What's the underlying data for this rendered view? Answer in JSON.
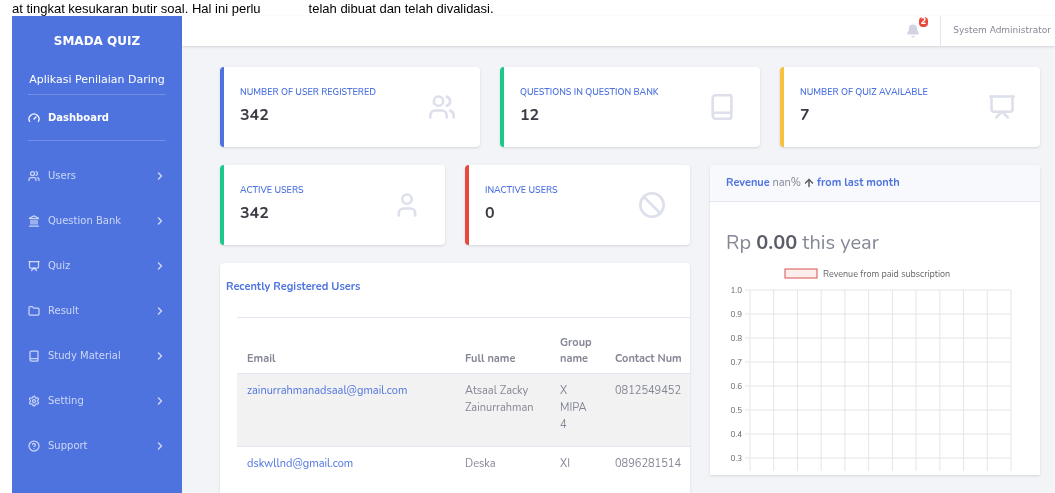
{
  "document_text": [
    "at tingkat kesukaran butir soal. Hal ini perlu",
    "telah dibuat dan telah divalidasi."
  ],
  "sidebar": {
    "brand": "SMADA QUIZ",
    "subtitle": "Aplikasi Penilaian Daring",
    "items": [
      {
        "kind": "dashboard",
        "label": "Dashboard",
        "selected": true
      },
      {
        "kind": "users",
        "label": "Users",
        "selected": false
      },
      {
        "kind": "bank",
        "label": "Question Bank",
        "selected": false
      },
      {
        "kind": "quiz",
        "label": "Quiz",
        "selected": false
      },
      {
        "kind": "result",
        "label": "Result",
        "selected": false
      },
      {
        "kind": "material",
        "label": "Study Material",
        "selected": false
      },
      {
        "kind": "setting",
        "label": "Setting",
        "selected": false
      },
      {
        "kind": "support",
        "label": "Support",
        "selected": false
      }
    ]
  },
  "topbar": {
    "notification_count": "2",
    "user": "System Administrator"
  },
  "stat_cards": [
    {
      "kind": "users",
      "label": "NUMBER OF USER REGISTERED",
      "value": "342",
      "color": "#4e73df"
    },
    {
      "kind": "book",
      "label": "QUESTIONS IN QUESTION BANK",
      "value": "12",
      "color": "#1cc88a"
    },
    {
      "kind": "quiz",
      "label": "NUMBER OF QUIZ AVAILABLE",
      "value": "7",
      "color": "#f6c23e"
    },
    {
      "kind": "user",
      "label": "ACTIVE USERS",
      "value": "342",
      "color": "#1cc88a"
    },
    {
      "kind": "ban",
      "label": "INACTIVE USERS",
      "value": "0",
      "color": "#e74a3b"
    }
  ],
  "recent_users": {
    "title": "Recently Registered Users",
    "columns": [
      "Email",
      "Full name",
      "Group name",
      "Contact Num"
    ],
    "rows": [
      [
        "zainurrahmanadsaal@gmail.com",
        "Atsaal Zacky Zainurrahman",
        "X MIPA 4",
        "0812549452"
      ],
      [
        "dskwllnd@gmail.com",
        "Deska",
        "XI",
        "0896281514"
      ]
    ]
  },
  "revenue": {
    "title": "Revenue",
    "percent": "nan%",
    "trend": "from last month",
    "currency": "Rp",
    "amount": "0.00",
    "period": "this year",
    "chart_data": {
      "type": "line",
      "grid": true,
      "ylim": [
        0.3,
        1.0
      ],
      "yticks": [
        {
          "value": 1,
          "label": "1.0"
        },
        {
          "value": 0.9,
          "label": "0.9"
        },
        {
          "value": 0.8,
          "label": "0.8"
        },
        {
          "value": 0.7,
          "label": "0.7"
        },
        {
          "value": 0.6,
          "label": "0.6"
        },
        {
          "value": 0.5,
          "label": "0.5"
        },
        {
          "value": 0.4,
          "label": "0.4"
        },
        {
          "value": 0.3,
          "label": "0.3"
        }
      ],
      "series": [
        {
          "name": "Revenue from paid subscription",
          "color": "#d9534f",
          "values": [
            null,
            null,
            null,
            null,
            null,
            null,
            null,
            null,
            null,
            null,
            null,
            null
          ]
        }
      ]
    }
  }
}
